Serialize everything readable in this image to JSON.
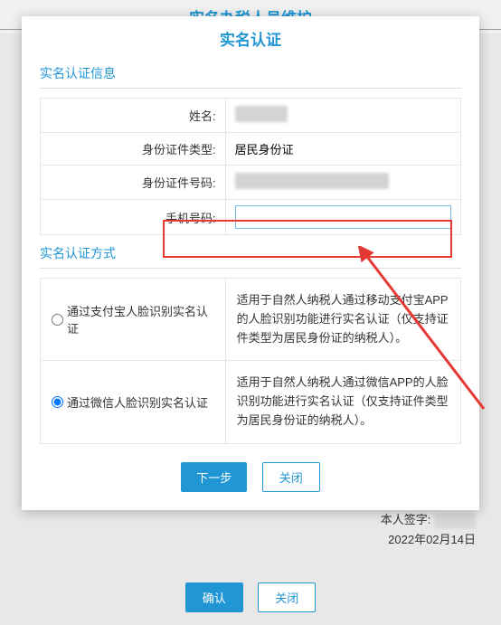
{
  "background": {
    "header_title": "实名办税人员维护",
    "signature_label": "本人签字:",
    "signature_date": "2022年02月14日",
    "confirm_label": "确认",
    "close_label": "关闭"
  },
  "modal": {
    "title": "实名认证",
    "section_info_title": "实名认证信息",
    "section_method_title": "实名认证方式",
    "form": {
      "name_label": "姓名:",
      "id_type_label": "身份证件类型:",
      "id_type_value": "居民身份证",
      "id_number_label": "身份证件号码:",
      "phone_label": "手机号码:",
      "phone_value": ""
    },
    "methods": [
      {
        "label": "通过支付宝人脸识别实名认证",
        "desc": "适用于自然人纳税人通过移动支付宝APP的人脸识别功能进行实名认证（仅支持证件类型为居民身份证的纳税人）。",
        "checked": false
      },
      {
        "label": "通过微信人脸识别实名认证",
        "desc": "适用于自然人纳税人通过微信APP的人脸识别功能进行实名认证（仅支持证件类型为居民身份证的纳税人）。",
        "checked": true
      }
    ],
    "next_label": "下一步",
    "close_label": "关闭"
  }
}
